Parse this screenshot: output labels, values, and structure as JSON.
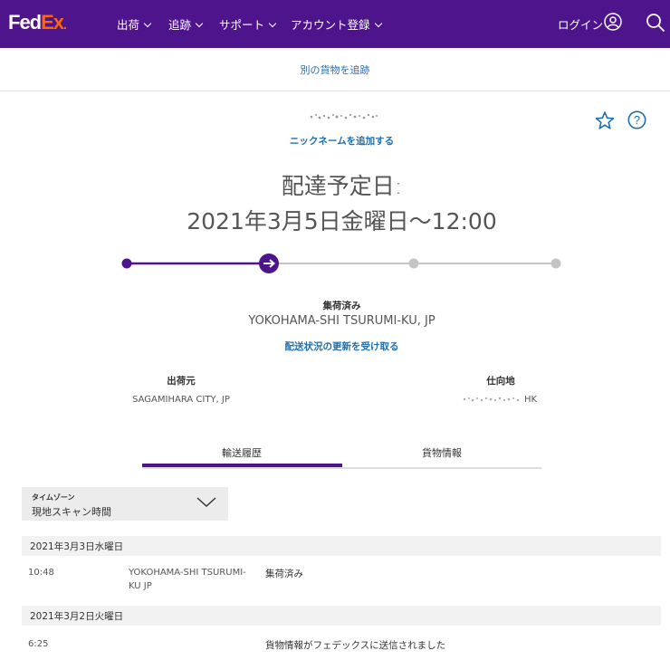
{
  "header": {
    "logo_fed": "Fed",
    "logo_ex": "Ex",
    "nav": [
      {
        "label": "出荷"
      },
      {
        "label": "追跡"
      },
      {
        "label": "サポート"
      },
      {
        "label": "アカウント登録"
      }
    ],
    "login_label": "ログイン",
    "brand_color": "#4d148c",
    "accent_color": "#ff6600"
  },
  "subheader": {
    "track_another_label": "別の貨物を追跡"
  },
  "shipment": {
    "add_nickname_label": "ニックネームを追加する",
    "estimated_delivery_title": "配達予定日:",
    "estimated_delivery_date": "2021年3月5日金曜日〜12:00",
    "progress_step_current": 2,
    "progress_step_total": 4,
    "status_label": "集荷済み",
    "status_location": "YOKOHAMA-SHI TSURUMI-KU, JP",
    "get_updates_label": "配送状況の更新を受け取る",
    "from_label": "出荷元",
    "from_value": "SAGAMIHARA CITY, JP",
    "to_label": "仕向地",
    "to_value": "HK"
  },
  "tabs": [
    {
      "label": "輸送履歴",
      "active": true
    },
    {
      "label": "貨物情報",
      "active": false
    }
  ],
  "timezone": {
    "label": "タイムゾーン",
    "value": "現地スキャン時間"
  },
  "history": [
    {
      "date": "2021年3月3日水曜日",
      "events": [
        {
          "time": "10:48",
          "location": "YOKOHAMA-SHI TSURUMI-KU JP",
          "description": "集荷済み"
        }
      ]
    },
    {
      "date": "2021年3月2日火曜日",
      "events": [
        {
          "time": "6:25",
          "location": "",
          "description": "貨物情報がフェデックスに送信されました"
        }
      ]
    }
  ],
  "icons": [
    "user-icon",
    "search-icon",
    "star-icon",
    "help-icon",
    "chevron-down-icon",
    "arrow-right-icon"
  ]
}
